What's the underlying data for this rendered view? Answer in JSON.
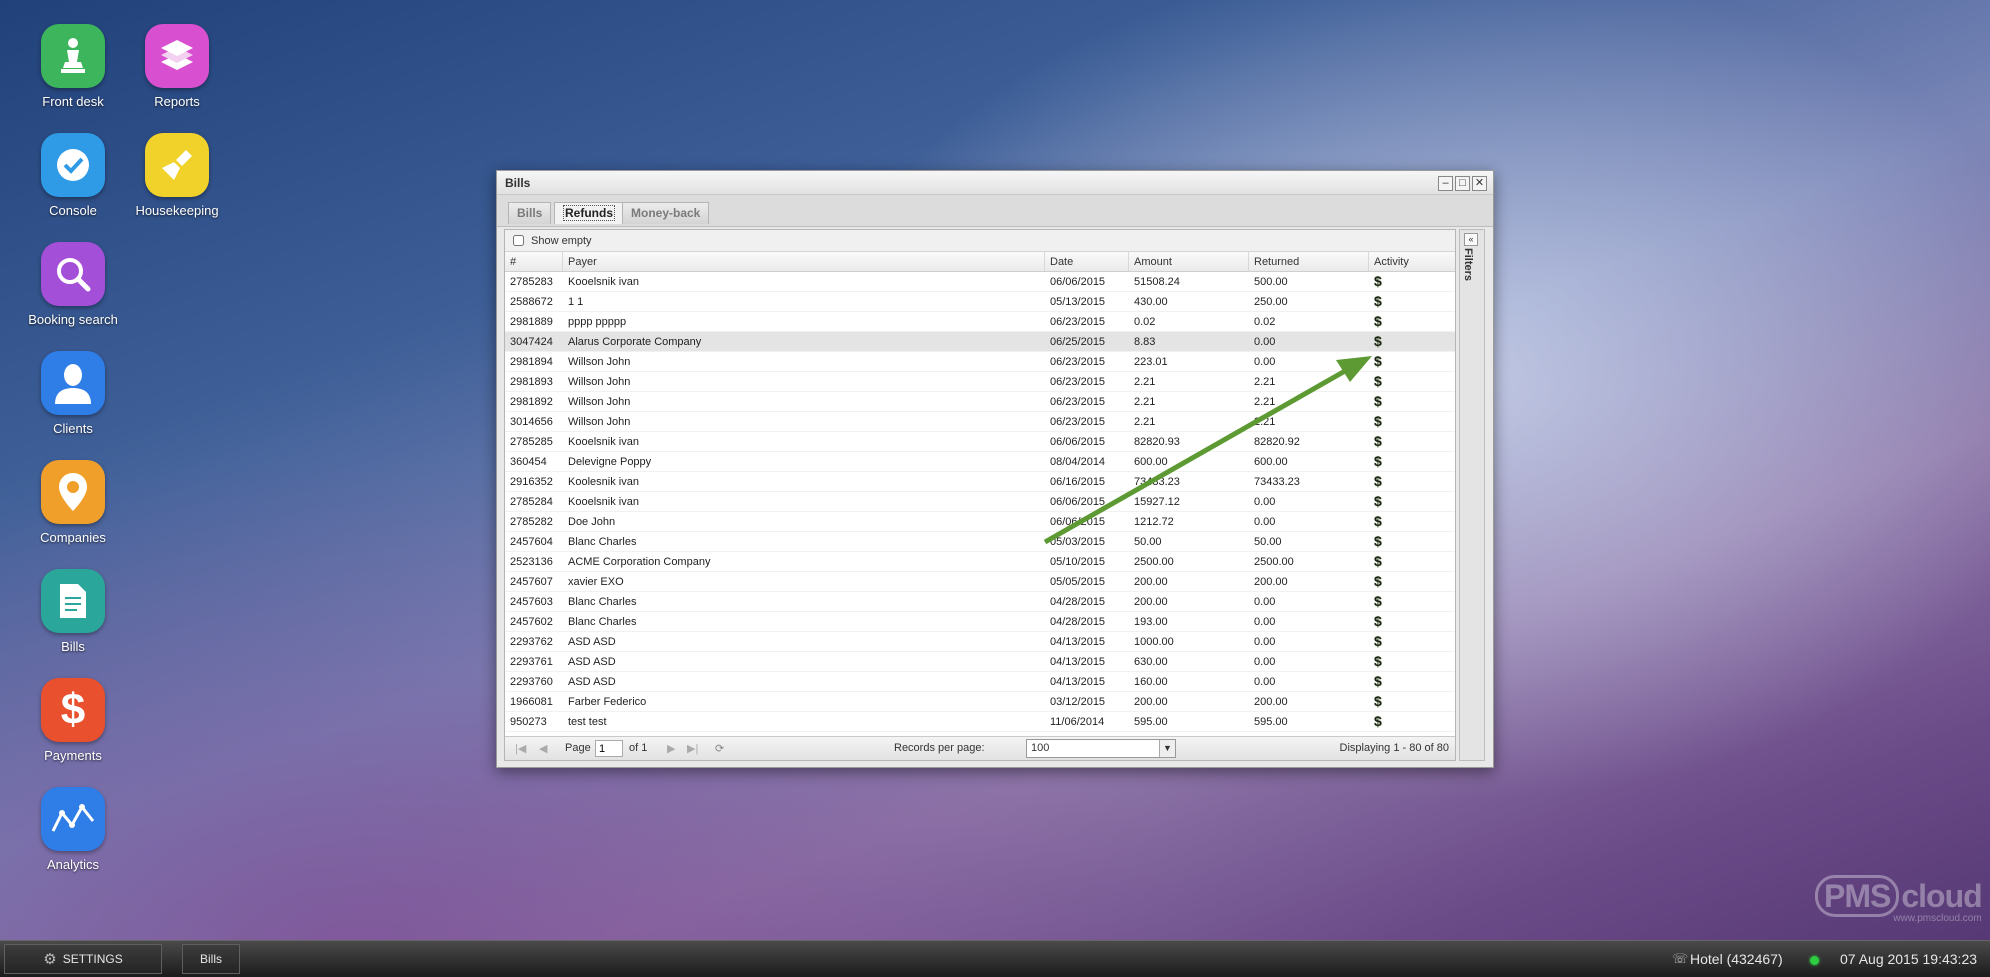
{
  "desktop": {
    "icons": [
      {
        "label": "Front desk",
        "color": "#3cb55c"
      },
      {
        "label": "Reports",
        "color": "#d84fd0"
      },
      {
        "label": "Console",
        "color": "#2f9be6"
      },
      {
        "label": "Housekeeping",
        "color": "#f0d22a"
      },
      {
        "label": "Booking search",
        "color": "#a44fd8"
      },
      {
        "label": "Clients",
        "color": "#2f7de6"
      },
      {
        "label": "Companies",
        "color": "#f0a02a"
      },
      {
        "label": "Bills",
        "color": "#2aa69a"
      },
      {
        "label": "Payments",
        "color": "#e8502e"
      },
      {
        "label": "Analytics",
        "color": "#2f7de6"
      }
    ]
  },
  "window": {
    "title": "Bills",
    "minimize": "–",
    "maximize": "□",
    "close": "✕",
    "tabs": [
      "Bills",
      "Refunds",
      "Money-back"
    ],
    "active_tab": "Refunds",
    "show_empty_label": "Show empty",
    "columns": [
      "#",
      "Payer",
      "Date",
      "Amount",
      "Returned",
      "Activity"
    ],
    "rows": [
      {
        "id": "2785283",
        "payer": "Kooelsnik ivan",
        "date": "06/06/2015",
        "amount": "51508.24",
        "returned": "500.00"
      },
      {
        "id": "2588672",
        "payer": "1 1",
        "date": "05/13/2015",
        "amount": "430.00",
        "returned": "250.00"
      },
      {
        "id": "2981889",
        "payer": "pppp ppppp",
        "date": "06/23/2015",
        "amount": "0.02",
        "returned": "0.02"
      },
      {
        "id": "3047424",
        "payer": "Alarus Corporate Company",
        "date": "06/25/2015",
        "amount": "8.83",
        "returned": "0.00",
        "selected": true
      },
      {
        "id": "2981894",
        "payer": "Willson John",
        "date": "06/23/2015",
        "amount": "223.01",
        "returned": "0.00"
      },
      {
        "id": "2981893",
        "payer": "Willson John",
        "date": "06/23/2015",
        "amount": "2.21",
        "returned": "2.21"
      },
      {
        "id": "2981892",
        "payer": "Willson John",
        "date": "06/23/2015",
        "amount": "2.21",
        "returned": "2.21"
      },
      {
        "id": "3014656",
        "payer": "Willson John",
        "date": "06/23/2015",
        "amount": "2.21",
        "returned": "2.21"
      },
      {
        "id": "2785285",
        "payer": "Kooelsnik ivan",
        "date": "06/06/2015",
        "amount": "82820.93",
        "returned": "82820.92"
      },
      {
        "id": "360454",
        "payer": "Delevigne Poppy",
        "date": "08/04/2014",
        "amount": "600.00",
        "returned": "600.00"
      },
      {
        "id": "2916352",
        "payer": "Koolesnik ivan",
        "date": "06/16/2015",
        "amount": "73433.23",
        "returned": "73433.23"
      },
      {
        "id": "2785284",
        "payer": "Kooelsnik ivan",
        "date": "06/06/2015",
        "amount": "15927.12",
        "returned": "0.00"
      },
      {
        "id": "2785282",
        "payer": "Doe John",
        "date": "06/06/2015",
        "amount": "1212.72",
        "returned": "0.00"
      },
      {
        "id": "2457604",
        "payer": "Blanc Charles",
        "date": "05/03/2015",
        "amount": "50.00",
        "returned": "50.00"
      },
      {
        "id": "2523136",
        "payer": "ACME Corporation Company",
        "date": "05/10/2015",
        "amount": "2500.00",
        "returned": "2500.00"
      },
      {
        "id": "2457607",
        "payer": "xavier EXO",
        "date": "05/05/2015",
        "amount": "200.00",
        "returned": "200.00"
      },
      {
        "id": "2457603",
        "payer": "Blanc Charles",
        "date": "04/28/2015",
        "amount": "200.00",
        "returned": "0.00"
      },
      {
        "id": "2457602",
        "payer": "Blanc Charles",
        "date": "04/28/2015",
        "amount": "193.00",
        "returned": "0.00"
      },
      {
        "id": "2293762",
        "payer": "ASD ASD",
        "date": "04/13/2015",
        "amount": "1000.00",
        "returned": "0.00"
      },
      {
        "id": "2293761",
        "payer": "ASD ASD",
        "date": "04/13/2015",
        "amount": "630.00",
        "returned": "0.00"
      },
      {
        "id": "2293760",
        "payer": "ASD ASD",
        "date": "04/13/2015",
        "amount": "160.00",
        "returned": "0.00"
      },
      {
        "id": "1966081",
        "payer": "Farber Federico",
        "date": "03/12/2015",
        "amount": "200.00",
        "returned": "200.00"
      },
      {
        "id": "950273",
        "payer": "test test",
        "date": "11/06/2014",
        "amount": "595.00",
        "returned": "595.00"
      }
    ],
    "activity_icon": "$",
    "pager": {
      "page_label": "Page",
      "page_value": "1",
      "of_label": "of 1",
      "records_label": "Records per page:",
      "records_value": "100",
      "display_text": "Displaying 1 - 80 of 80"
    },
    "filters_label": "Filters",
    "collapse_label": "«"
  },
  "taskbar": {
    "settings_label": "SETTINGS",
    "bills_label": "Bills",
    "hotel_label": "Hotel (432467)",
    "datetime": "07 Aug 2015 19:43:23"
  },
  "watermark": {
    "pms": "PMS",
    "cloud": "cloud",
    "url": "www.pmscloud.com"
  },
  "accent_colors": {
    "arrow": "#5e9a33",
    "status_dot": "#2ecc40"
  }
}
